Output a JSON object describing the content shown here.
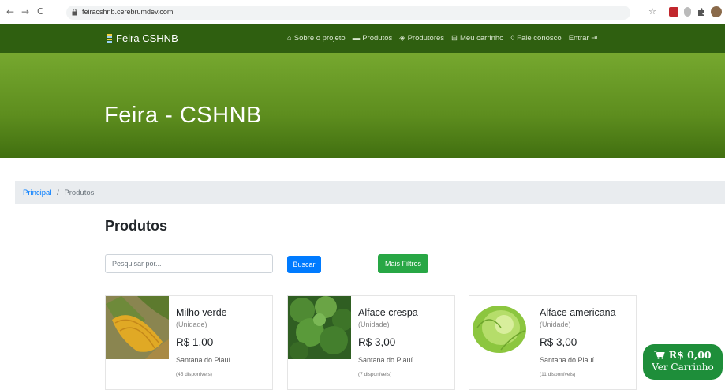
{
  "browser": {
    "url": "feiracshnb.cerebrumdev.com",
    "back": "←",
    "forward": "→",
    "reload": "C",
    "star": "☆"
  },
  "navbar": {
    "brand": "Feira CSHNB",
    "menu": [
      {
        "icon": "home-icon",
        "glyph": "⌂",
        "label": "Sobre o projeto"
      },
      {
        "icon": "store-icon",
        "glyph": "▬",
        "label": "Produtos"
      },
      {
        "icon": "handshake-icon",
        "glyph": "◈",
        "label": "Produtores"
      },
      {
        "icon": "cart-icon",
        "glyph": "⊟",
        "label": "Meu carrinho"
      },
      {
        "icon": "comments-icon",
        "glyph": "◊",
        "label": "Fale conosco"
      },
      {
        "icon": "sign-in-icon",
        "glyph": "⇥",
        "label": "Entrar"
      }
    ]
  },
  "hero": {
    "title": "Feira - CSHNB"
  },
  "breadcrumb": {
    "home": "Principal",
    "separator": "/",
    "current": "Produtos"
  },
  "page": {
    "title": "Produtos",
    "search_placeholder": "Pesquisar por...",
    "search_button": "Buscar",
    "filters_button": "Mais Filtros"
  },
  "products": [
    {
      "name": "Milho verde",
      "unit": "(Unidade)",
      "price": "R$ 1,00",
      "city": "Santana do Piauí",
      "available": "(45 disponíveis)"
    },
    {
      "name": "Alface crespa",
      "unit": "(Unidade)",
      "price": "R$ 3,00",
      "city": "Santana do Piauí",
      "available": "(7 disponíveis)"
    },
    {
      "name": "Alface americana",
      "unit": "(Unidade)",
      "price": "R$ 3,00",
      "city": "Santana do Piauí",
      "available": "(11 disponíveis)"
    }
  ],
  "cart": {
    "total": "R$ 0,00",
    "label": "Ver Carrinho"
  },
  "colors": {
    "navbar": "#2f5f10",
    "hero": "#6a9a27",
    "primary": "#007bff",
    "success": "#28a745",
    "cart": "#1e8e3a"
  }
}
